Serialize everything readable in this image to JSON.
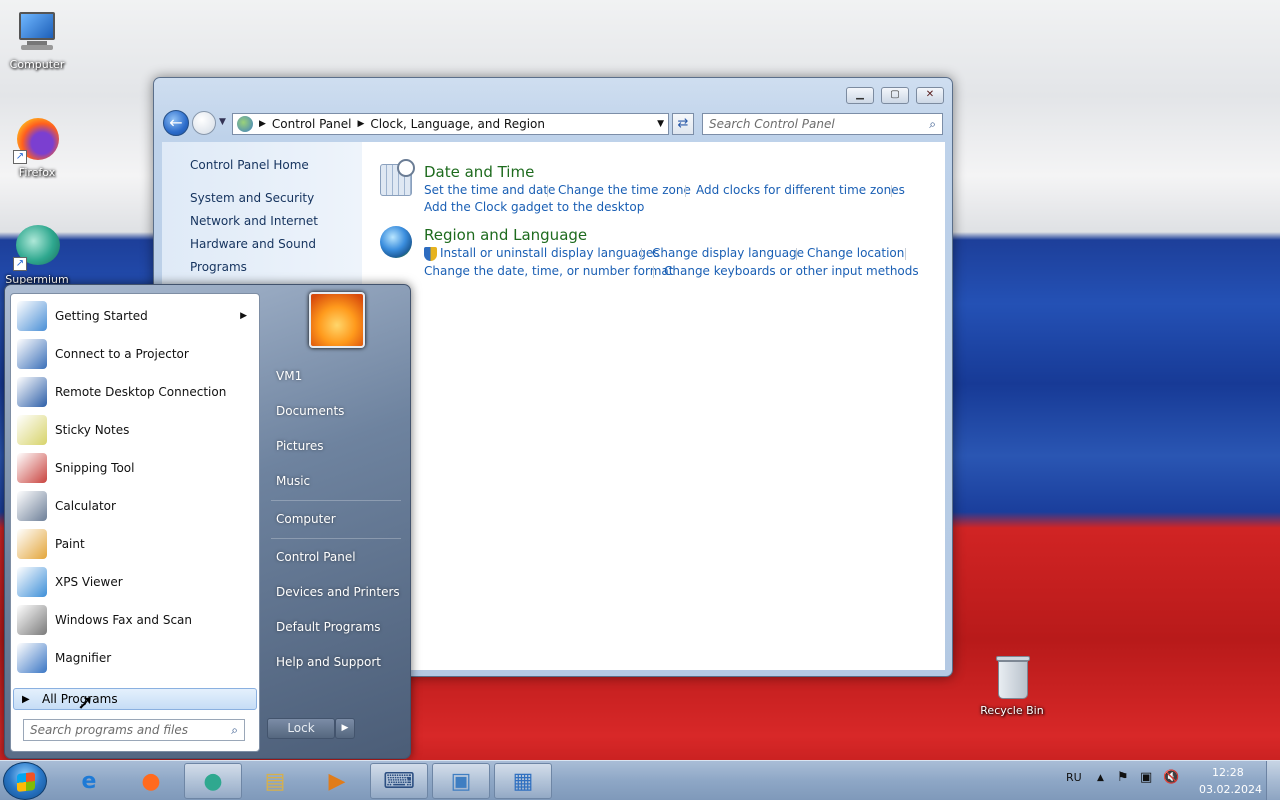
{
  "desktop": {
    "icons": [
      {
        "label": "Computer"
      },
      {
        "label": "Firefox"
      },
      {
        "label": "Supermium"
      },
      {
        "label": "Recycle Bin"
      }
    ]
  },
  "window": {
    "breadcrumb": [
      "Control Panel",
      "Clock, Language, and Region"
    ],
    "search_placeholder": "Search Control Panel",
    "left_links": [
      "Control Panel Home",
      "System and Security",
      "Network and Internet",
      "Hardware and Sound",
      "Programs"
    ],
    "categories": [
      {
        "title": "Date and Time",
        "icon": "clock-icon",
        "links_row1": [
          "Set the time and date",
          "Change the time zone",
          "Add clocks for different time zones"
        ],
        "links_row2": [
          "Add the Clock gadget to the desktop"
        ]
      },
      {
        "title": "Region and Language",
        "icon": "globe-icon",
        "links_row1": [
          "Install or uninstall display languages",
          "Change display language",
          "Change location"
        ],
        "links_row2": [
          "Change the date, time, or number format",
          "Change keyboards or other input methods"
        ]
      }
    ]
  },
  "start_menu": {
    "programs": [
      {
        "label": "Getting Started",
        "icon": "getting-started-icon",
        "color": "#4a8fd6",
        "submenu": true
      },
      {
        "label": "Connect to a Projector",
        "icon": "projector-icon",
        "color": "#3a6fb8"
      },
      {
        "label": "Remote Desktop Connection",
        "icon": "remote-desktop-icon",
        "color": "#2d5fa8"
      },
      {
        "label": "Sticky Notes",
        "icon": "sticky-notes-icon",
        "color": "#d7d36a"
      },
      {
        "label": "Snipping Tool",
        "icon": "scissors-icon",
        "color": "#c9443f"
      },
      {
        "label": "Calculator",
        "icon": "calculator-icon",
        "color": "#6d7f98"
      },
      {
        "label": "Paint",
        "icon": "paint-palette-icon",
        "color": "#e3a53a"
      },
      {
        "label": "XPS Viewer",
        "icon": "xps-viewer-icon",
        "color": "#3d8fd8"
      },
      {
        "label": "Windows Fax and Scan",
        "icon": "fax-icon",
        "color": "#7a7a7a"
      },
      {
        "label": "Magnifier",
        "icon": "magnifier-icon",
        "color": "#3a76c4"
      }
    ],
    "all_programs": "All Programs",
    "search_placeholder": "Search programs and files",
    "right_items": [
      "VM1",
      "Documents",
      "Pictures",
      "Music",
      "Computer",
      "Control Panel",
      "Devices and Printers",
      "Default Programs",
      "Help and Support"
    ],
    "lock_label": "Lock"
  },
  "taskbar": {
    "language": "RU",
    "time": "12:28",
    "date": "03.02.2024",
    "pinned": [
      {
        "name": "ie-icon",
        "glyph": "e",
        "color": "#1e7ad6"
      },
      {
        "name": "firefox-icon",
        "glyph": "●",
        "color": "#ff6a1e"
      },
      {
        "name": "supermium-icon",
        "glyph": "●",
        "color": "#2fa88f"
      },
      {
        "name": "explorer-icon",
        "glyph": "▤",
        "color": "#d7b04a"
      },
      {
        "name": "media-player-icon",
        "glyph": "▶",
        "color": "#e07c1a"
      },
      {
        "name": "keyboard-icon",
        "glyph": "⌨",
        "color": "#2c4f82"
      },
      {
        "name": "picture-viewer-icon",
        "glyph": "▣",
        "color": "#3f7ec2"
      },
      {
        "name": "control-panel-icon",
        "glyph": "▦",
        "color": "#3070c0"
      }
    ]
  }
}
